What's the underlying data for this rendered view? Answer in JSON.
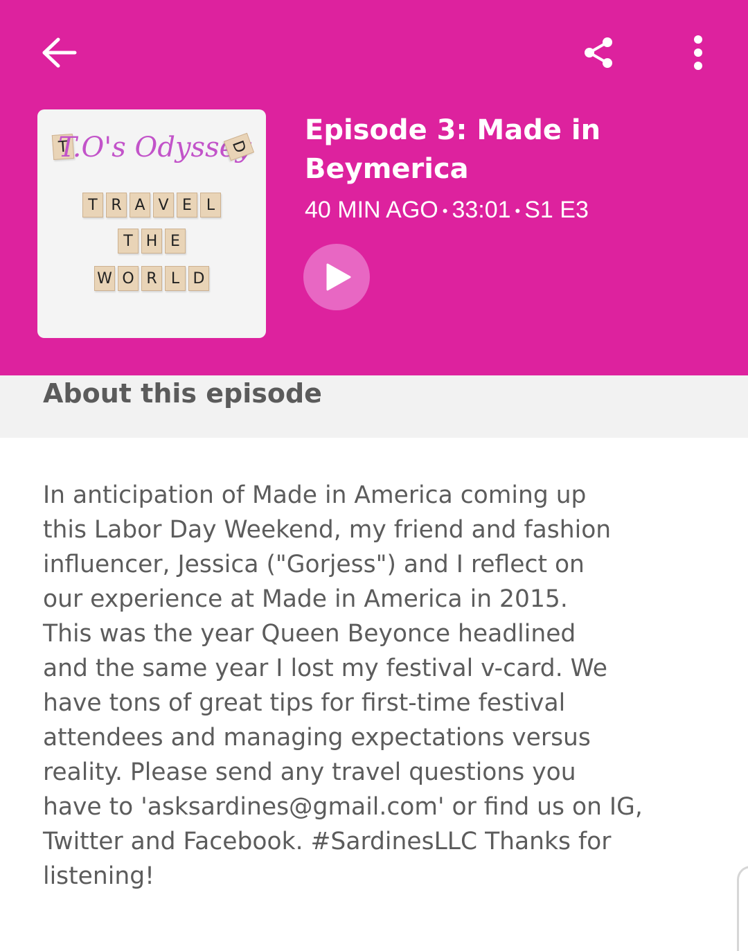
{
  "header": {
    "background_color": "#dd229e",
    "back_icon": "arrow-left-icon",
    "share_icon": "share-icon",
    "more_icon": "more-vertical-icon"
  },
  "podcast_art": {
    "title": "T.O's Odyssey",
    "rows": [
      [
        "T",
        "R",
        "A",
        "V",
        "E",
        "L"
      ],
      [
        "T",
        "H",
        "E"
      ],
      [
        "W",
        "O",
        "R",
        "L",
        "D"
      ]
    ],
    "corner_tile_left": "T",
    "corner_tile_right": "D"
  },
  "episode": {
    "title": "Episode 3: Made in Beymerica",
    "published": "40 MIN AGO",
    "duration": "33:01",
    "season_episode": "S1 E3",
    "separator": "•",
    "play_icon": "play-icon",
    "play_button_color": "#e867c3"
  },
  "about": {
    "heading": "About this episode",
    "description": "In anticipation of Made in America coming up\nthis Labor Day Weekend, my friend and fashion\ninfluencer, Jessica (\"Gorjess\") and I reflect on\nour experience at Made in America in 2015.\n This was the year Queen Beyonce headlined\nand the same year I lost my festival v-card.  We\nhave tons of great tips for first-time festival\nattendees and managing expectations versus\nreality.  Please send any travel questions you\nhave to 'asksardines@gmail.com' or find us on IG,\nTwitter and Facebook.  #SardinesLLC Thanks for\nlistening!"
  }
}
